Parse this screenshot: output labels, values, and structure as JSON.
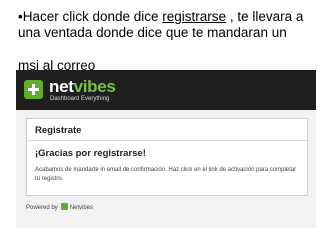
{
  "caption": {
    "prefix": "•Hacer click donde dice ",
    "link": "registrarse",
    "suffix": " , te llevara a una ventada donde dice que te mandaran un",
    "line_extra": "msj al correo"
  },
  "screenshot": {
    "brand_net": "net",
    "brand_vibes": "vibes",
    "tagline": "Dashboard Everything",
    "panel_title": "Registrate",
    "thanks_heading": "¡Gracias por registrarse!",
    "body_text": "Acabamos de mandarte in email de confirmación. Haz click en el link de activación para completar tu registro.",
    "footer_label": "Powered by",
    "footer_brand": "Netvibes"
  },
  "colors": {
    "topbar": "#1f1f1f",
    "brand_green": "#7ac142",
    "logo_green": "#5fae2a"
  },
  "icons": [
    "plus-logo-icon"
  ]
}
